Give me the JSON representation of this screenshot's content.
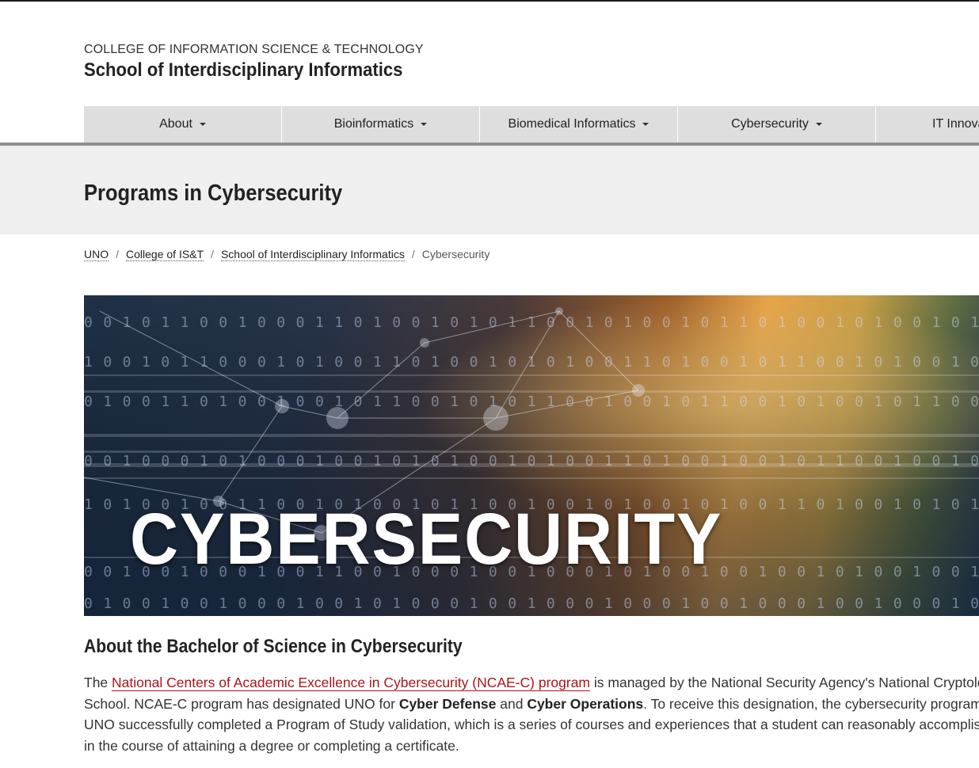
{
  "header": {
    "college": "COLLEGE OF INFORMATION SCIENCE & TECHNOLOGY",
    "school": "School of Interdisciplinary Informatics"
  },
  "nav": {
    "items": [
      {
        "label": "About"
      },
      {
        "label": "Bioinformatics"
      },
      {
        "label": "Biomedical Informatics"
      },
      {
        "label": "Cybersecurity"
      },
      {
        "label": "IT Innova"
      }
    ]
  },
  "page": {
    "title": "Programs in Cybersecurity"
  },
  "breadcrumb": {
    "items": [
      "UNO",
      "College of IS&T",
      "School of Interdisciplinary Informatics"
    ],
    "current": "Cybersecurity",
    "separator": "/"
  },
  "hero": {
    "text": "CYBERSECURITY"
  },
  "about": {
    "title": "About the Bachelor of Science in Cybersecurity",
    "p_the": "The ",
    "p_link": "National Centers of Academic Excellence in Cybersecurity (NCAE-C) program",
    "p_l1_rest": " is managed by the National Security Agency's National Cryptolo",
    "p_l2_a": "School. NCAE-C program has designated UNO for ",
    "p_b1": "Cyber Defense",
    "p_and": " and ",
    "p_b2": "Cyber Operations",
    "p_l2_rest": ". To receive this designation, the cybersecurity program at",
    "p_l3": "UNO successfully completed a Program of Study validation, which is a series of courses and experiences that a student can reasonably accomplis",
    "p_l4": "in the course of attaining a degree or completing a certificate."
  },
  "colors": {
    "link": "#b0121b",
    "nav_bg": "#dedede",
    "band_bg": "#efefef"
  }
}
